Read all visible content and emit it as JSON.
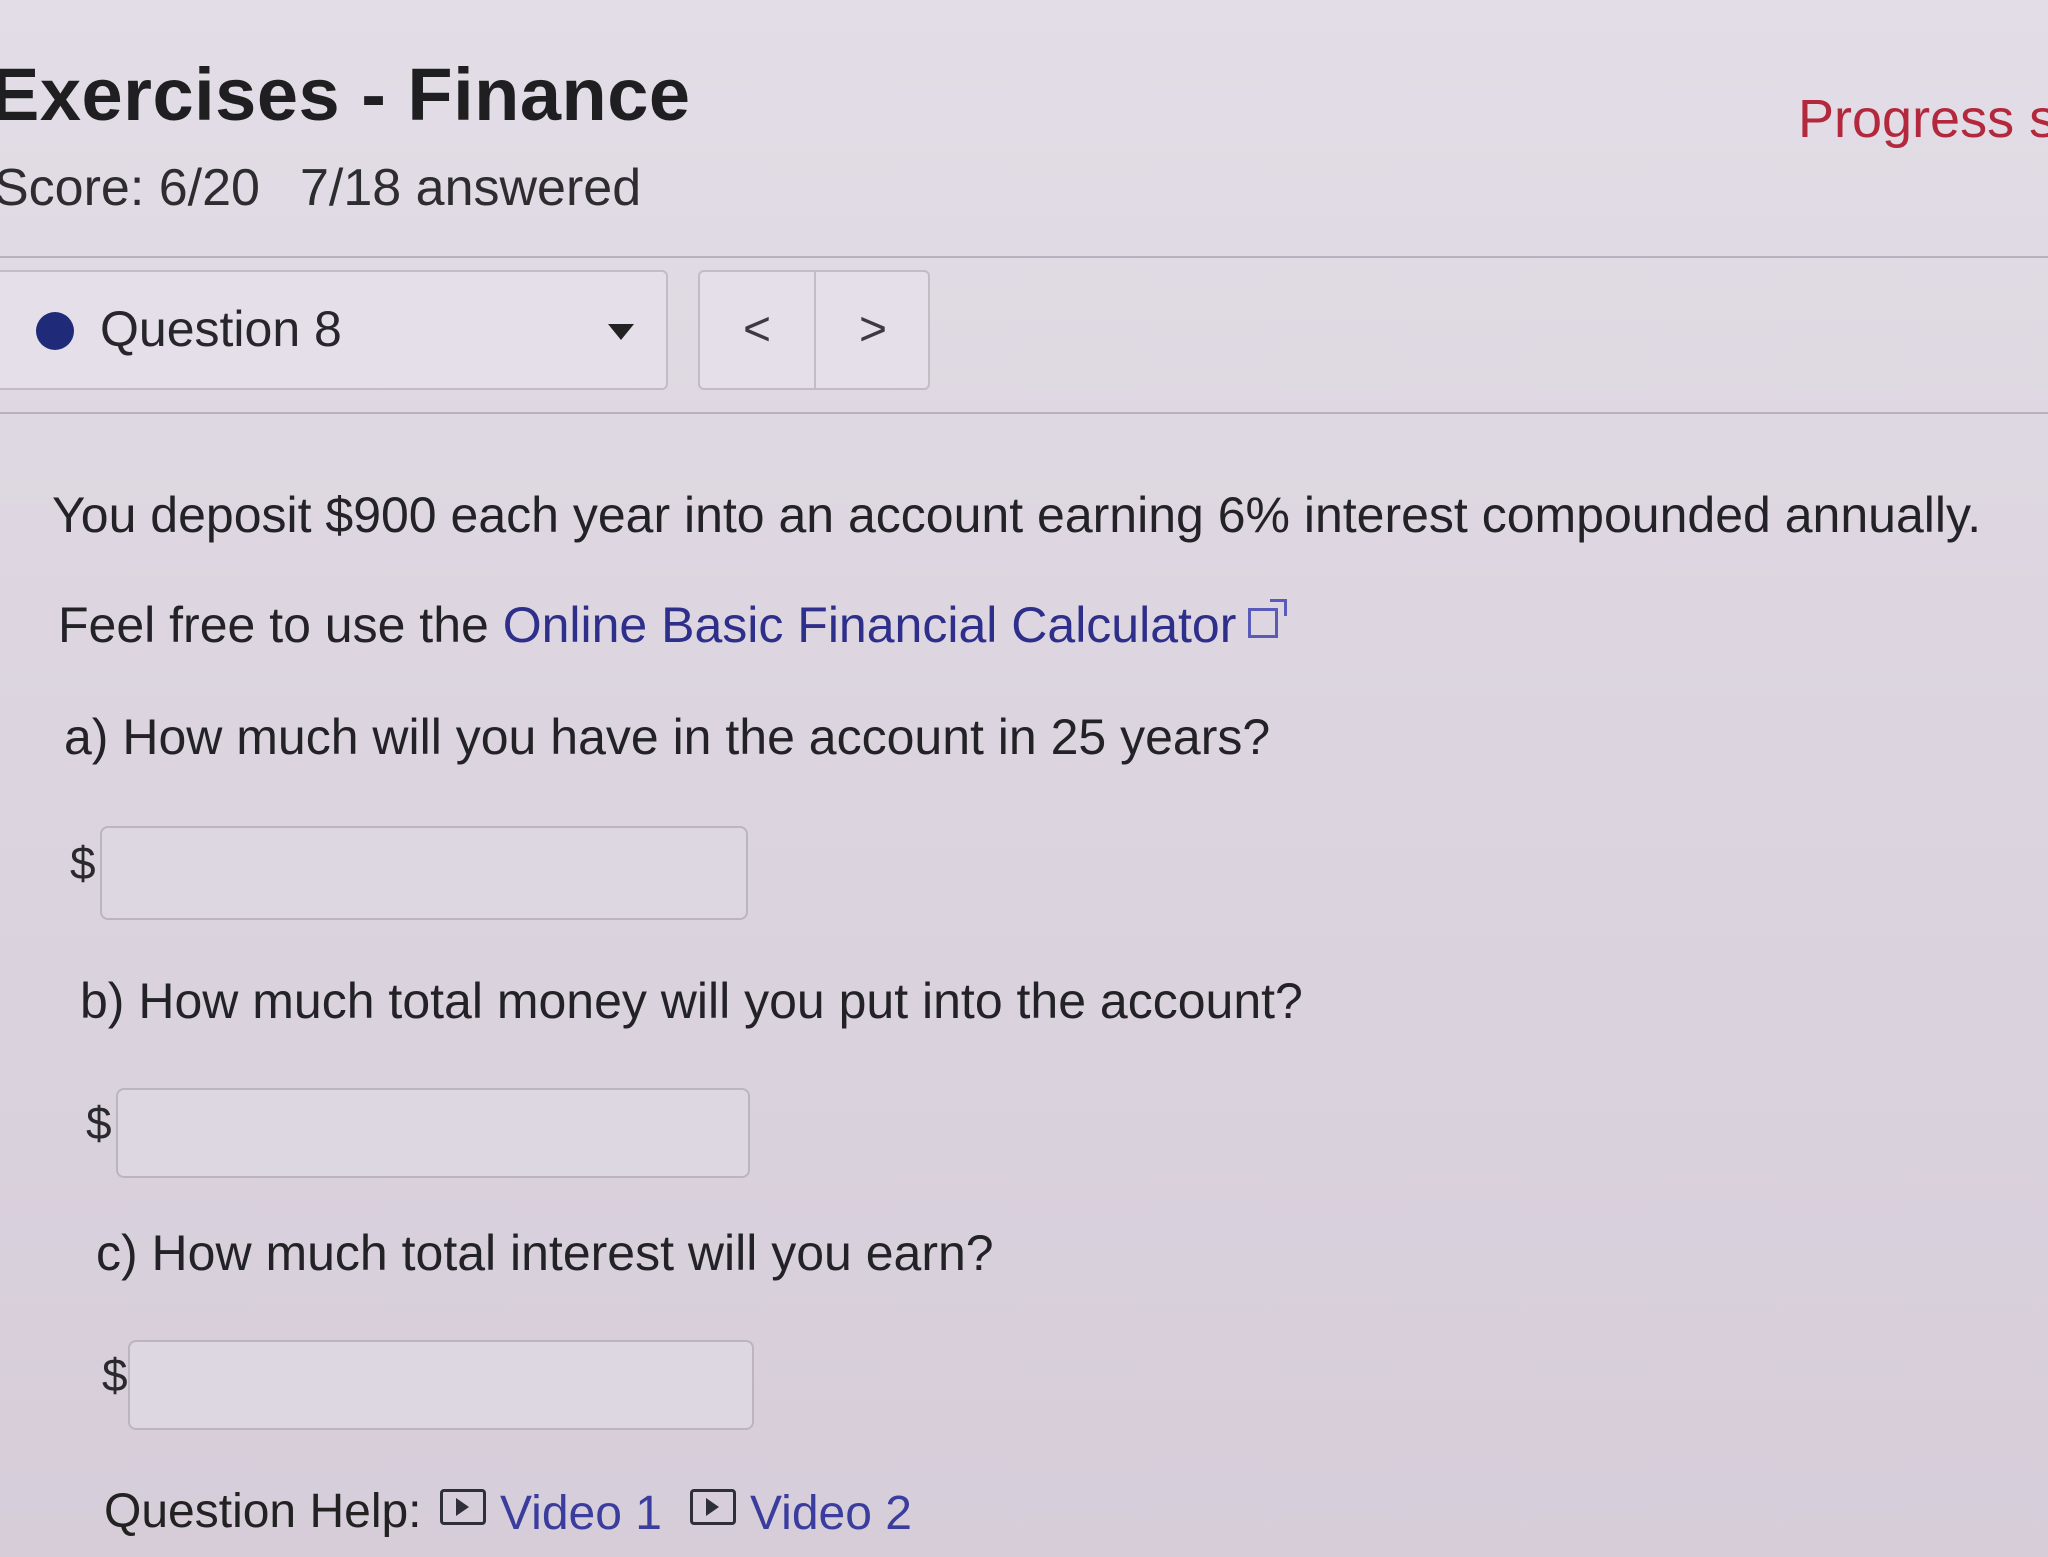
{
  "header": {
    "title": "Exercises - Finance",
    "progress_label": "Progress s",
    "score": "Score: 6/20",
    "answered": "7/18 answered"
  },
  "question_nav": {
    "selected": "Question 8",
    "prev": "<",
    "next": ">"
  },
  "question": {
    "intro": "You deposit $900 each year into an account earning 6% interest compounded annually.",
    "calculator_prefix": "Feel free to use the ",
    "calculator_link": "Online Basic Financial Calculator",
    "parts": [
      {
        "prompt": "a) How much will you have in the account in 25 years?",
        "currency": "$",
        "value": ""
      },
      {
        "prompt": "b) How much total money will you put into the account?",
        "currency": "$",
        "value": ""
      },
      {
        "prompt": "c) How much total interest will you earn?",
        "currency": "$",
        "value": ""
      }
    ]
  },
  "help": {
    "label": "Question Help:",
    "links": [
      "Video 1",
      "Video 2"
    ]
  },
  "colors": {
    "accent_link": "#2e2f8a",
    "progress": "#b3283c",
    "question_dot": "#1f2a78"
  },
  "icons": [
    "chevron-down-icon",
    "chevron-left-icon",
    "chevron-right-icon",
    "external-link-icon",
    "video-play-icon"
  ]
}
